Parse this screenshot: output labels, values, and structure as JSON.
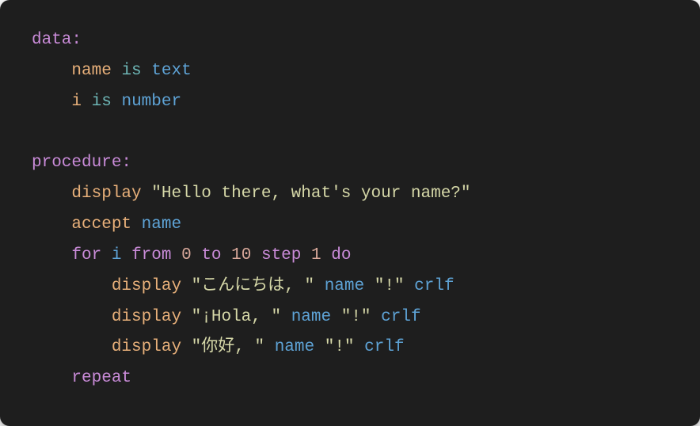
{
  "code": {
    "line1": {
      "data_kw": "data:"
    },
    "line2": {
      "name_var": "name",
      "is_kw": "is",
      "text_type": "text"
    },
    "line3": {
      "i_var": "i",
      "is_kw": "is",
      "number_type": "number"
    },
    "line5": {
      "procedure_kw": "procedure:"
    },
    "line6": {
      "display_kw": "display",
      "string1": "\"Hello there, what's your name?\""
    },
    "line7": {
      "accept_kw": "accept",
      "name_var": "name"
    },
    "line8": {
      "for_kw": "for",
      "i_var": "i",
      "from_kw": "from",
      "zero": "0",
      "to_kw": "to",
      "ten": "10",
      "step_kw": "step",
      "one": "1",
      "do_kw": "do"
    },
    "line9": {
      "display_kw": "display",
      "string1": "\"こんにちは, \"",
      "name_var": "name",
      "string2": "\"!\"",
      "crlf_kw": "crlf"
    },
    "line10": {
      "display_kw": "display",
      "string1": "\"¡Hola, \"",
      "name_var": "name",
      "string2": "\"!\"",
      "crlf_kw": "crlf"
    },
    "line11": {
      "display_kw": "display",
      "string1": "\"你好, \"",
      "name_var": "name",
      "string2": "\"!\"",
      "crlf_kw": "crlf"
    },
    "line12": {
      "repeat_kw": "repeat"
    }
  }
}
